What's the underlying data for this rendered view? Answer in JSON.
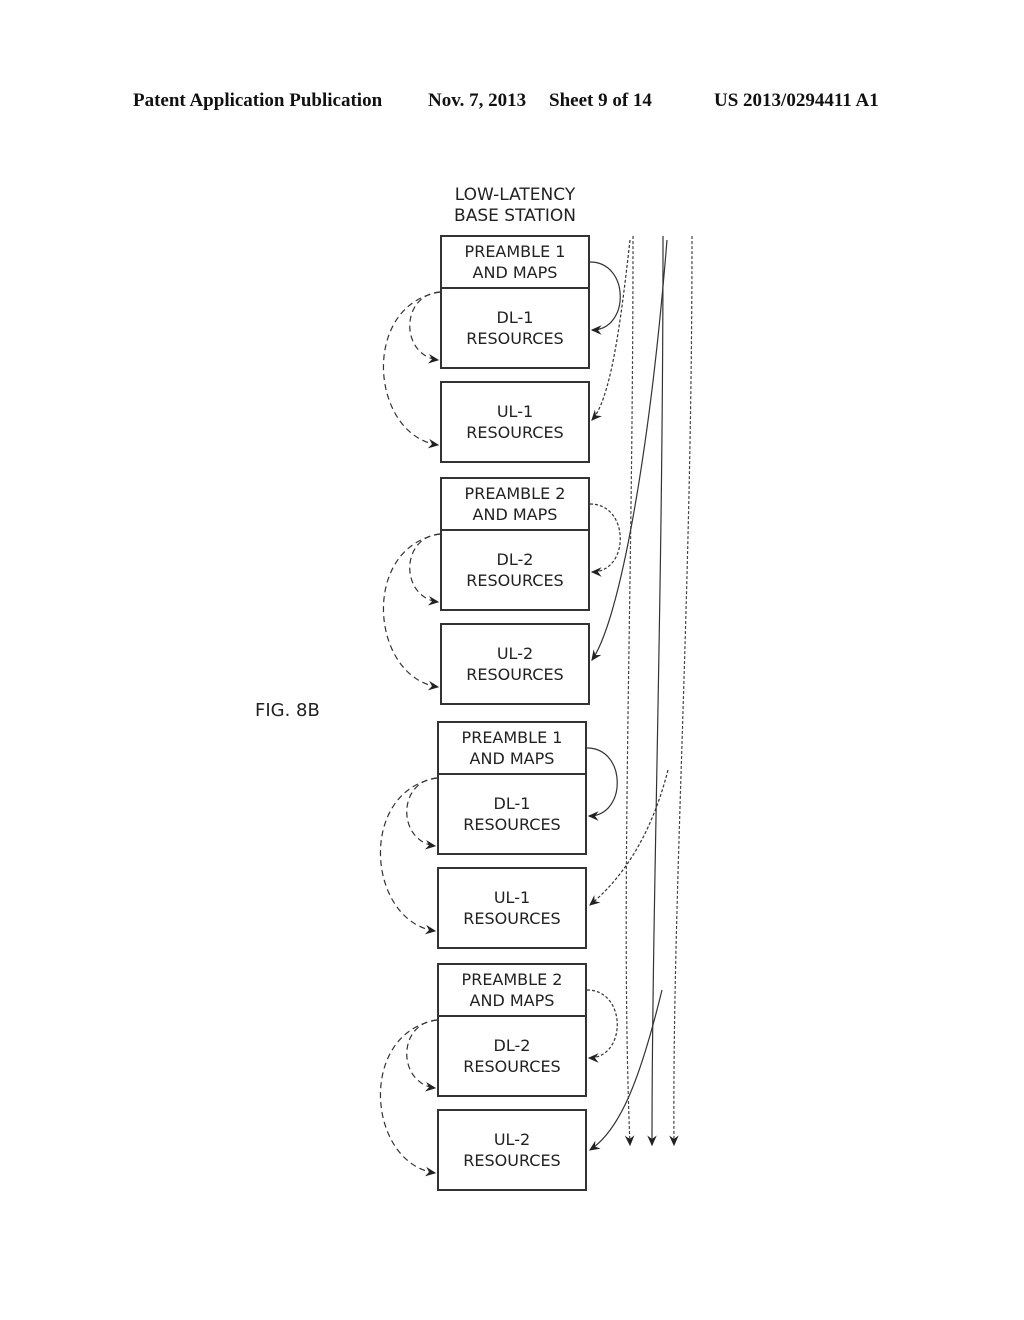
{
  "header": {
    "publication": "Patent Application Publication",
    "date": "Nov. 7, 2013",
    "sheet": "Sheet 9 of 14",
    "number": "US 2013/0294411 A1"
  },
  "figure": {
    "label": "FIG. 8B",
    "title_line1": "LOW-LATENCY",
    "title_line2": "BASE STATION",
    "frames": [
      {
        "preamble": [
          "PREAMBLE 1",
          "AND MAPS"
        ],
        "dl": [
          "DL-1",
          "RESOURCES"
        ],
        "ul": [
          "UL-1",
          "RESOURCES"
        ]
      },
      {
        "preamble": [
          "PREAMBLE 2",
          "AND MAPS"
        ],
        "dl": [
          "DL-2",
          "RESOURCES"
        ],
        "ul": [
          "UL-2",
          "RESOURCES"
        ]
      },
      {
        "preamble": [
          "PREAMBLE 1",
          "AND MAPS"
        ],
        "dl": [
          "DL-1",
          "RESOURCES"
        ],
        "ul": [
          "UL-1",
          "RESOURCES"
        ]
      },
      {
        "preamble": [
          "PREAMBLE 2",
          "AND MAPS"
        ],
        "dl": [
          "DL-2",
          "RESOURCES"
        ],
        "ul": [
          "UL-2",
          "RESOURCES"
        ]
      }
    ]
  }
}
